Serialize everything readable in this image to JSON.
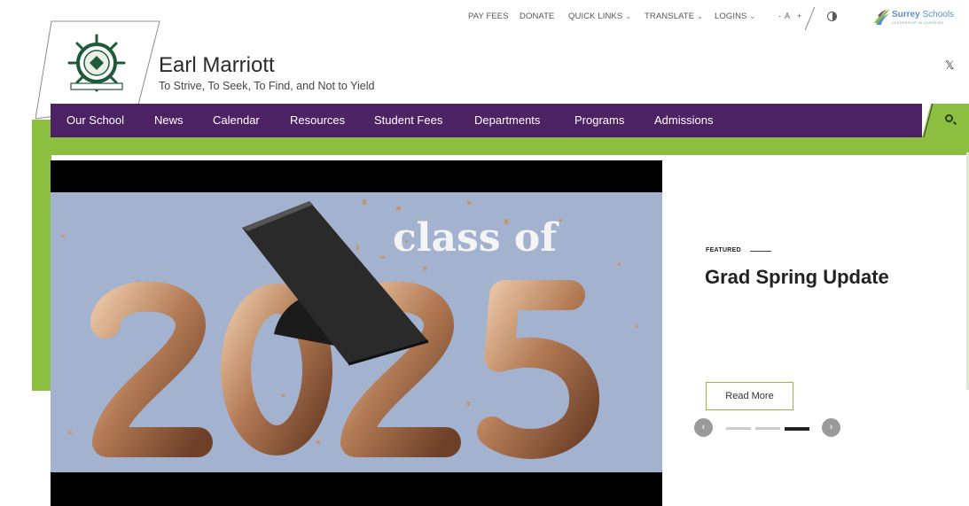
{
  "utility_nav": {
    "pay_fees": "PAY FEES",
    "donate": "DONATE",
    "quick_links": "QUICK LINKS",
    "translate": "TRANSLATE",
    "logins": "LOGINS",
    "font_decrease": "-",
    "font_label": "A",
    "font_increase": "+",
    "chevron": "⌄"
  },
  "district_logo": {
    "name_part1": "Surrey",
    "name_part2": " Schools",
    "tagline": "LEADERSHIP IN LEARNING"
  },
  "header": {
    "school_name": "Earl Marriott",
    "motto": "To Strive, To Seek, To Find, and Not to Yield",
    "social_icon": "𝕏"
  },
  "main_nav": [
    "Our School",
    "News",
    "Calendar",
    "Resources",
    "Student Fees",
    "Departments",
    "Programs",
    "Admissions"
  ],
  "hero": {
    "headline": "class of",
    "year": "2025"
  },
  "featured": {
    "label": "FEATURED",
    "title": "Grad Spring Update",
    "button": "Read More",
    "prev_icon": "‹",
    "next_icon": "›",
    "slide_count": 3,
    "active_slide": 3
  },
  "colors": {
    "nav_purple": "#4d2264",
    "accent_green": "#8cbe3f",
    "hero_bg": "#a2b2cf",
    "balloon_bronze": "#b9855f"
  }
}
